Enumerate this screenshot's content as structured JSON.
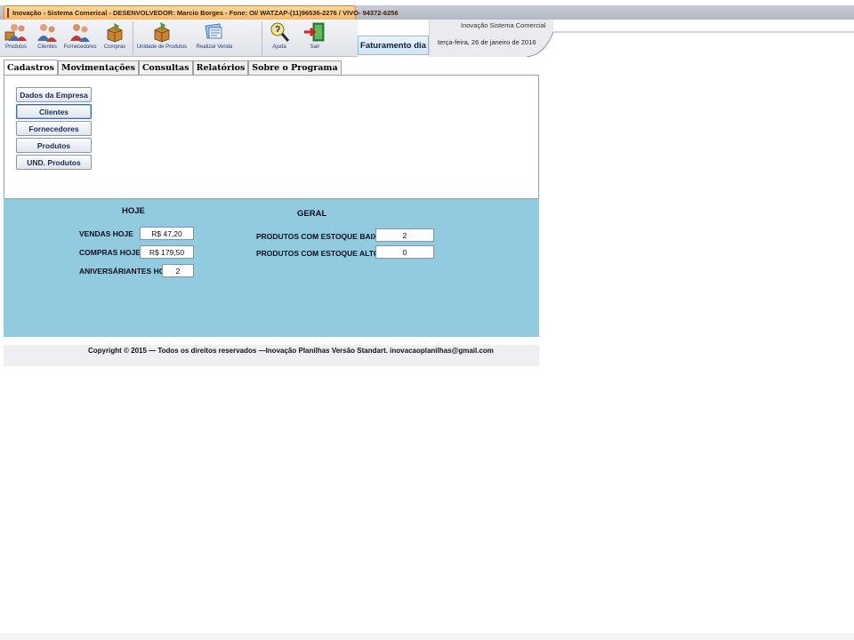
{
  "window": {
    "title": "Inovação - Sistema Comerical - DESENVOLVEDOR:  Marcio Borges - Fone: OI/ WATZAP-(11)96536-2276 / VIVO- 94372-6256"
  },
  "ribbon": {
    "buttons": [
      {
        "label": "Produtos",
        "icon": "users-boxes-icon"
      },
      {
        "label": "Clientes",
        "icon": "clients-icon"
      },
      {
        "label": "Fornecedores",
        "icon": "suppliers-icon"
      },
      {
        "label": "Compras",
        "icon": "purchases-box-icon"
      },
      {
        "label": "Unidade de Produtos",
        "icon": "product-unit-box-icon"
      },
      {
        "label": "Realizar Venda",
        "icon": "sale-form-icon"
      },
      {
        "label": "Ajuda",
        "icon": "help-magnifier-icon"
      },
      {
        "label": "Sair",
        "icon": "exit-door-icon"
      }
    ],
    "faturamento_label": "Faturamento dia"
  },
  "info": {
    "app_name": "Inovação Sistema Comercial",
    "date": "terça-feira, 26 de janeiro de 2016"
  },
  "tabs": [
    "Cadastros",
    "Movimentações",
    "Consultas",
    "Relatórios",
    "Sobre o Programa"
  ],
  "active_tab": "Cadastros",
  "cadastros": {
    "buttons": [
      "Dados da Empresa",
      "Clientes",
      "Fornecedores",
      "Produtos",
      "UND. Produtos"
    ]
  },
  "hoje": {
    "heading": "HOJE",
    "vendas_label": "VENDAS HOJE",
    "vendas_value": "R$ 47,20",
    "compras_label": "COMPRAS HOJE",
    "compras_value": "R$ 179,50",
    "aniversariantes_label": "ANIVERSÁRIANTES HOJE",
    "aniversariantes_value": "2"
  },
  "geral": {
    "heading": "GERAL",
    "estoque_baixo_label": "PRODUTOS COM ESTOQUE BAIXO",
    "estoque_baixo_value": "2",
    "estoque_alto_label": "PRODUTOS COM ESTOQUE ALTO",
    "estoque_alto_value": "0"
  },
  "footer": {
    "copyright": "Copyright ©  2015 — Todos os direitos reservados —Inovação Planilhas   Versão Standart.   inovacaoplanilhas@gmail.com"
  },
  "colors": {
    "dashboard_bg": "#92cbdf",
    "title_tab": "#f5b86a",
    "button_text": "#1d2a57"
  }
}
